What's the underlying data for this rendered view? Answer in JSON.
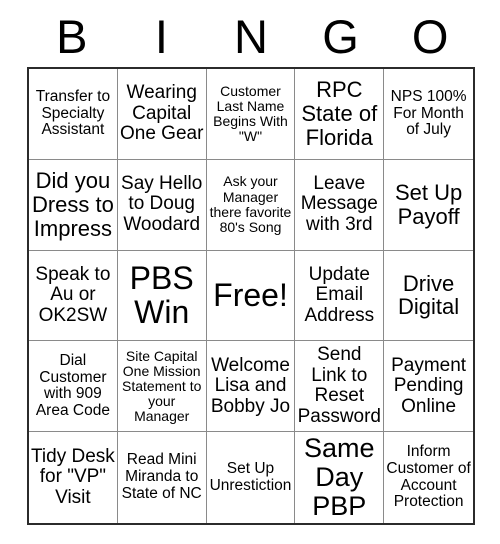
{
  "card": {
    "title": "BINGO",
    "header_letters": [
      "B",
      "I",
      "N",
      "G",
      "O"
    ],
    "free_space_label": "Free!",
    "grid_size": "5x5",
    "colors": {
      "outer_border": "#2b2b2b",
      "inner_border": "#8a8a8a",
      "text": "#000000",
      "background": "#ffffff"
    }
  },
  "cells": [
    {
      "text": "Transfer to Specialty Assistant",
      "size": "s"
    },
    {
      "text": "Wearing Capital One Gear",
      "size": "m"
    },
    {
      "text": "Customer Last Name Begins With \"W\"",
      "size": "xs"
    },
    {
      "text": "RPC State of Florida",
      "size": "l"
    },
    {
      "text": "NPS 100% For Month of July",
      "size": "s"
    },
    {
      "text": "Did you Dress to Impress",
      "size": "l"
    },
    {
      "text": "Say Hello to Doug Woodard",
      "size": "m"
    },
    {
      "text": "Ask your Manager there favorite 80's Song",
      "size": "xs"
    },
    {
      "text": "Leave Message with 3rd",
      "size": "m"
    },
    {
      "text": "Set Up Payoff",
      "size": "l"
    },
    {
      "text": "Speak to Au or OK2SW",
      "size": "m"
    },
    {
      "text": "PBS Win",
      "size": "xxl"
    },
    {
      "text": "Free!",
      "size": "xxl"
    },
    {
      "text": "Update Email Address",
      "size": "m"
    },
    {
      "text": "Drive Digital",
      "size": "l"
    },
    {
      "text": "Dial Customer with 909 Area Code",
      "size": "s"
    },
    {
      "text": "Site Capital One Mission Statement to your Manager",
      "size": "xs"
    },
    {
      "text": "Welcome Lisa and Bobby Jo",
      "size": "m"
    },
    {
      "text": "Send Link to Reset Password",
      "size": "m"
    },
    {
      "text": "Payment Pending Online",
      "size": "m"
    },
    {
      "text": "Tidy Desk for \"VP\" Visit",
      "size": "m"
    },
    {
      "text": "Read Mini Miranda to State of NC",
      "size": "s"
    },
    {
      "text": "Set Up Unrestiction",
      "size": "s"
    },
    {
      "text": "Same Day PBP",
      "size": "xl"
    },
    {
      "text": "Inform Customer of Account Protection",
      "size": "s"
    }
  ]
}
